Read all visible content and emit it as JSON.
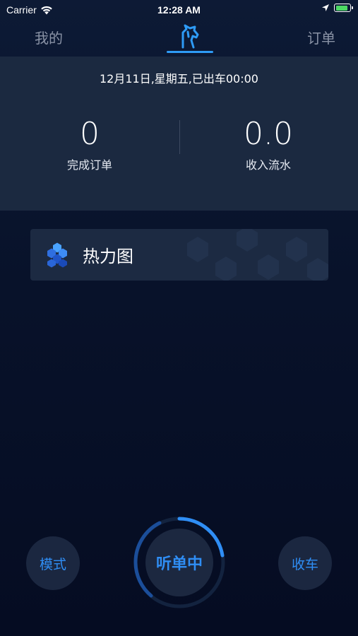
{
  "status_bar": {
    "carrier": "Carrier",
    "time": "12:28 AM",
    "battery_level": 0.9,
    "battery_color": "#4cd964"
  },
  "nav": {
    "left_label": "我的",
    "right_label": "订单",
    "center_icon": "horse-head-logo-icon",
    "accent_color": "#2e9bf6"
  },
  "stats": {
    "date_line": "12月11日,星期五,已出车00:00",
    "orders_value": "0",
    "orders_label": "完成订单",
    "income_value": "0.0",
    "income_label": "收入流水"
  },
  "heatmap": {
    "icon": "hexagon-cluster-icon",
    "label": "热力图"
  },
  "controls": {
    "mode_label": "模式",
    "listen_label": "听单中",
    "finish_label": "收车",
    "accent_color": "#2f8ef5"
  }
}
